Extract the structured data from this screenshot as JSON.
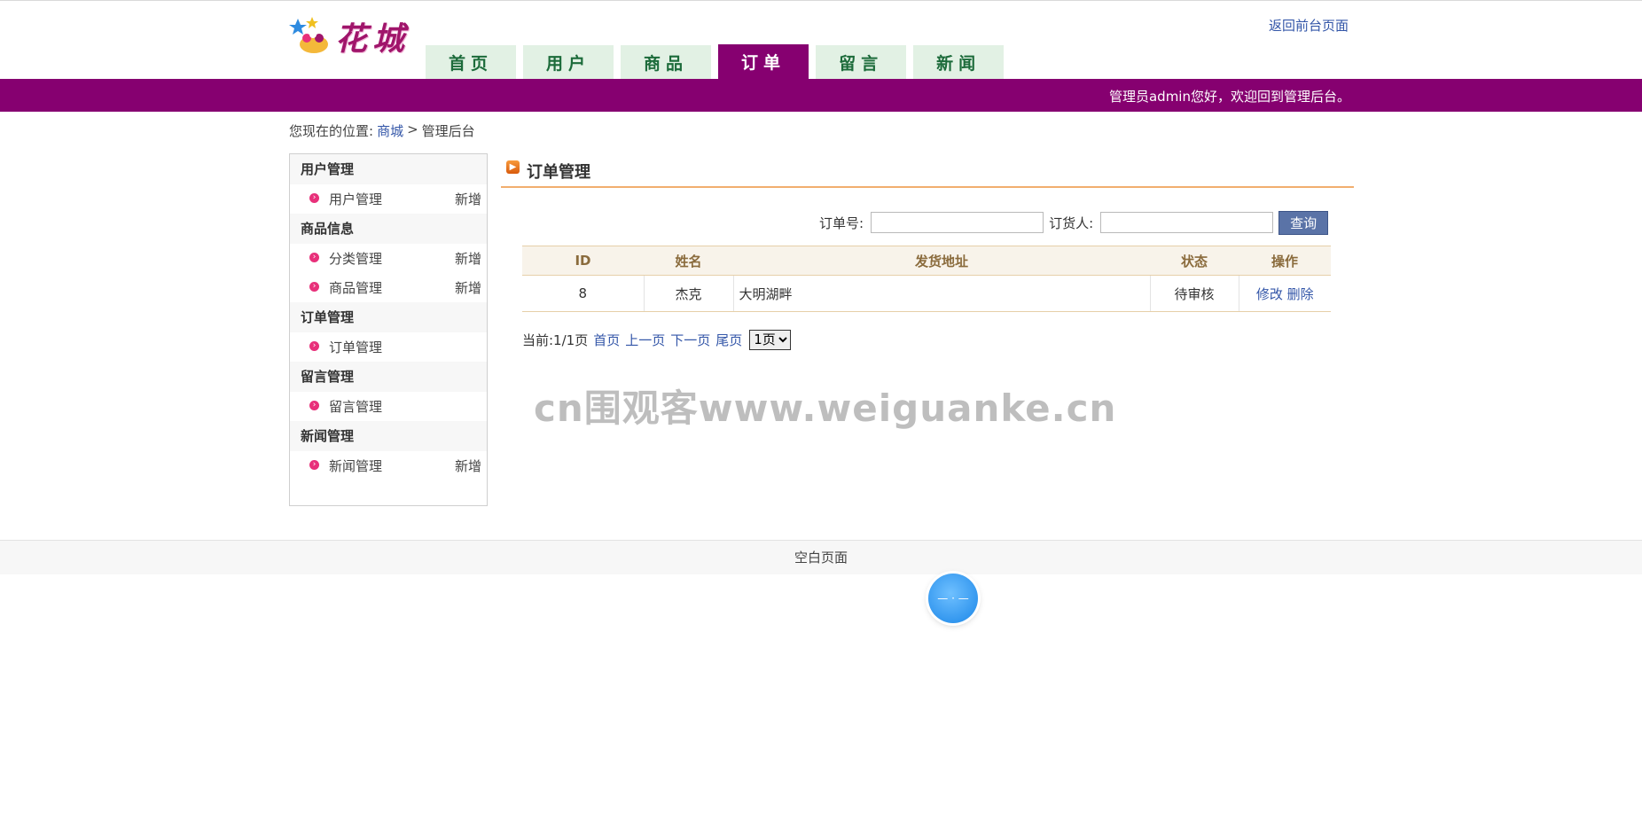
{
  "header": {
    "logo_text": "花城",
    "back_link": "返回前台页面",
    "nav": [
      {
        "label": "首页",
        "active": false
      },
      {
        "label": "用户",
        "active": false
      },
      {
        "label": "商品",
        "active": false
      },
      {
        "label": "订单",
        "active": true
      },
      {
        "label": "留言",
        "active": false
      },
      {
        "label": "新闻",
        "active": false
      }
    ]
  },
  "welcome": "管理员admin您好，欢迎回到管理后台。",
  "breadcrumb": {
    "prefix": "您现在的位置:",
    "home": "商城",
    "separator": ">",
    "current": "管理后台"
  },
  "sidebar": {
    "groups": [
      {
        "title": "用户管理",
        "items": [
          {
            "label": "用户管理",
            "add": "新增"
          }
        ]
      },
      {
        "title": "商品信息",
        "items": [
          {
            "label": "分类管理",
            "add": "新增"
          },
          {
            "label": "商品管理",
            "add": "新增"
          }
        ]
      },
      {
        "title": "订单管理",
        "items": [
          {
            "label": "订单管理",
            "add": ""
          }
        ]
      },
      {
        "title": "留言管理",
        "items": [
          {
            "label": "留言管理",
            "add": ""
          }
        ]
      },
      {
        "title": "新闻管理",
        "items": [
          {
            "label": "新闻管理",
            "add": "新增"
          }
        ]
      }
    ]
  },
  "main": {
    "title": "订单管理",
    "search": {
      "order_no_label": "订单号:",
      "order_no_value": "",
      "orderer_label": "订货人:",
      "orderer_value": "",
      "button": "查询"
    },
    "table": {
      "headers": [
        "ID",
        "姓名",
        "发货地址",
        "状态",
        "操作"
      ],
      "rows": [
        {
          "id": "8",
          "name": "杰克",
          "address": "大明湖畔",
          "status": "待审核",
          "edit": "修改",
          "delete": "删除"
        }
      ]
    },
    "pager": {
      "current": "当前:1/1页",
      "first": "首页",
      "prev": "上一页",
      "next": "下一页",
      "last": "尾页",
      "select_value": "1页"
    },
    "watermark": "cn围观客www.weiguanke.cn"
  },
  "footer": "空白页面",
  "colors": {
    "purple": "#860070",
    "nav_tab": "#e2f1e4",
    "nav_text": "#1c6b3a",
    "link": "#3356a8",
    "title_rule": "#f1ae6e",
    "table_head": "#f8f3ea",
    "search_button": "#5a73a7"
  }
}
